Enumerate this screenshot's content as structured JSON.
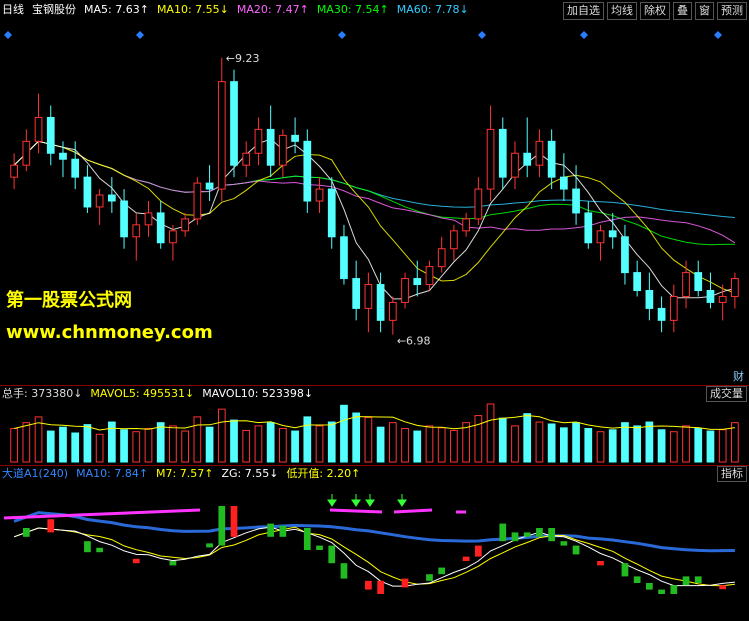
{
  "header": {
    "period": "日线",
    "stock_name": "宝钢股份",
    "ma": [
      {
        "label": "MA5: 7.63",
        "arrow": "↑",
        "color": "#ffffff"
      },
      {
        "label": "MA10: 7.55",
        "arrow": "↓",
        "color": "#ffff00"
      },
      {
        "label": "MA20: 7.47",
        "arrow": "↑",
        "color": "#ff66ff"
      },
      {
        "label": "MA30: 7.54",
        "arrow": "↑",
        "color": "#00ff00"
      },
      {
        "label": "MA60: 7.78",
        "arrow": "↓",
        "color": "#33ccff"
      }
    ]
  },
  "toolbar": [
    "加自选",
    "均线",
    "除权",
    "叠",
    "窗",
    "预测"
  ],
  "price_annotations": {
    "high": "9.23",
    "low": "6.98",
    "cai": "财"
  },
  "volume": {
    "label": "总手: 373380",
    "label_arrow": "↓",
    "mavol5": "MAVOL5: 495531",
    "mavol5_arrow": "↓",
    "mavol10": "MAVOL10: 523398",
    "mavol10_arrow": "↓",
    "tag": "成交量"
  },
  "indicator": {
    "name": "大道A1(240)",
    "ma10": "MA10: 7.84",
    "ma10_arrow": "↑",
    "m7": "M7: 7.57",
    "m7_arrow": "↑",
    "zg": "ZG: 7.55",
    "zg_arrow": "↓",
    "low": "低开值: 2.20",
    "low_arrow": "↑",
    "tag": "指标"
  },
  "watermark": {
    "line1": "第一股票公式网",
    "line2": "www.chnmoney.com"
  },
  "colors": {
    "up": "#ff3333",
    "down": "#54ffff",
    "ma5": "#ffffff",
    "ma10": "#ffff00",
    "ma20": "#ff66ff",
    "ma30": "#00ff00",
    "ma60": "#33ccff",
    "blue_line": "#2a6ad8",
    "ind_up": "#ff2020",
    "ind_down": "#22bb22",
    "magenta": "#ff33ff",
    "arrow_green": "#33ff33"
  },
  "chart_data": {
    "type": "candlestick",
    "ylim": [
      6.6,
      9.6
    ],
    "candles": [
      [
        8.3,
        8.5,
        8.2,
        8.4
      ],
      [
        8.4,
        8.7,
        8.35,
        8.6
      ],
      [
        8.6,
        9.0,
        8.5,
        8.8
      ],
      [
        8.8,
        8.9,
        8.4,
        8.5
      ],
      [
        8.5,
        8.6,
        8.3,
        8.45
      ],
      [
        8.45,
        8.6,
        8.2,
        8.3
      ],
      [
        8.3,
        8.4,
        8.0,
        8.05
      ],
      [
        8.05,
        8.2,
        7.9,
        8.15
      ],
      [
        8.15,
        8.3,
        8.0,
        8.1
      ],
      [
        8.1,
        8.2,
        7.7,
        7.8
      ],
      [
        7.8,
        8.0,
        7.6,
        7.9
      ],
      [
        7.9,
        8.1,
        7.8,
        8.0
      ],
      [
        8.0,
        8.1,
        7.7,
        7.75
      ],
      [
        7.75,
        7.9,
        7.6,
        7.85
      ],
      [
        7.85,
        8.0,
        7.8,
        7.95
      ],
      [
        7.95,
        8.3,
        7.9,
        8.25
      ],
      [
        8.25,
        8.4,
        8.1,
        8.2
      ],
      [
        8.2,
        9.3,
        8.1,
        9.1
      ],
      [
        9.1,
        9.2,
        8.3,
        8.4
      ],
      [
        8.4,
        8.6,
        8.3,
        8.5
      ],
      [
        8.5,
        8.8,
        8.4,
        8.7
      ],
      [
        8.7,
        8.9,
        8.3,
        8.4
      ],
      [
        8.4,
        8.7,
        8.3,
        8.65
      ],
      [
        8.65,
        8.8,
        8.5,
        8.6
      ],
      [
        8.6,
        8.7,
        8.0,
        8.1
      ],
      [
        8.1,
        8.3,
        8.0,
        8.2
      ],
      [
        8.2,
        8.3,
        7.7,
        7.8
      ],
      [
        7.8,
        7.9,
        7.4,
        7.45
      ],
      [
        7.45,
        7.6,
        7.1,
        7.2
      ],
      [
        7.2,
        7.5,
        7.0,
        7.4
      ],
      [
        7.4,
        7.5,
        7.0,
        7.1
      ],
      [
        7.1,
        7.3,
        6.98,
        7.25
      ],
      [
        7.25,
        7.5,
        7.2,
        7.45
      ],
      [
        7.45,
        7.6,
        7.3,
        7.4
      ],
      [
        7.4,
        7.6,
        7.35,
        7.55
      ],
      [
        7.55,
        7.8,
        7.5,
        7.7
      ],
      [
        7.7,
        7.9,
        7.6,
        7.85
      ],
      [
        7.85,
        8.0,
        7.8,
        7.95
      ],
      [
        7.95,
        8.3,
        7.9,
        8.2
      ],
      [
        8.2,
        8.9,
        8.1,
        8.7
      ],
      [
        8.7,
        8.8,
        8.2,
        8.3
      ],
      [
        8.3,
        8.6,
        8.2,
        8.5
      ],
      [
        8.5,
        8.8,
        8.3,
        8.4
      ],
      [
        8.4,
        8.7,
        8.3,
        8.6
      ],
      [
        8.6,
        8.7,
        8.2,
        8.3
      ],
      [
        8.3,
        8.5,
        8.1,
        8.2
      ],
      [
        8.2,
        8.4,
        7.9,
        8.0
      ],
      [
        8.0,
        8.1,
        7.7,
        7.75
      ],
      [
        7.75,
        7.9,
        7.6,
        7.85
      ],
      [
        7.85,
        8.0,
        7.7,
        7.8
      ],
      [
        7.8,
        7.9,
        7.4,
        7.5
      ],
      [
        7.5,
        7.6,
        7.3,
        7.35
      ],
      [
        7.35,
        7.5,
        7.1,
        7.2
      ],
      [
        7.2,
        7.3,
        7.0,
        7.1
      ],
      [
        7.1,
        7.4,
        7.0,
        7.3
      ],
      [
        7.3,
        7.6,
        7.2,
        7.5
      ],
      [
        7.5,
        7.6,
        7.3,
        7.35
      ],
      [
        7.35,
        7.5,
        7.2,
        7.25
      ],
      [
        7.25,
        7.4,
        7.1,
        7.3
      ],
      [
        7.3,
        7.5,
        7.2,
        7.45
      ]
    ],
    "volumes": [
      520,
      610,
      700,
      480,
      540,
      450,
      580,
      430,
      620,
      500,
      470,
      520,
      610,
      560,
      480,
      700,
      540,
      820,
      650,
      490,
      560,
      610,
      520,
      480,
      700,
      560,
      620,
      880,
      760,
      690,
      540,
      610,
      520,
      480,
      560,
      530,
      490,
      610,
      720,
      900,
      680,
      560,
      750,
      620,
      590,
      530,
      610,
      520,
      470,
      500,
      610,
      560,
      620,
      500,
      470,
      560,
      520,
      480,
      500,
      610
    ],
    "ind_bars": [
      0,
      -1,
      0,
      1,
      0,
      0,
      -1,
      -1,
      0,
      0,
      1,
      0,
      0,
      -1,
      0,
      0,
      -1,
      -1,
      1,
      0,
      0,
      -1,
      -1,
      0,
      -1,
      -1,
      -1,
      -1,
      0,
      1,
      1,
      0,
      1,
      0,
      -1,
      -1,
      0,
      1,
      1,
      0,
      -1,
      -1,
      -1,
      -1,
      -1,
      -1,
      -1,
      0,
      1,
      0,
      -1,
      -1,
      -1,
      -1,
      -1,
      -1,
      -1,
      0,
      1,
      0
    ]
  }
}
